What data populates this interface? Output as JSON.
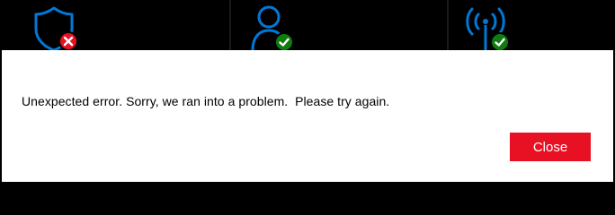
{
  "tiles": [
    {
      "icon": "shield-icon",
      "status": "error",
      "status_icon": "error-badge-icon"
    },
    {
      "icon": "person-icon",
      "status": "ok",
      "status_icon": "check-badge-icon"
    },
    {
      "icon": "wireless-icon",
      "status": "ok",
      "status_icon": "check-badge-icon"
    }
  ],
  "dialog": {
    "message": "Unexpected error. Sorry, we ran into a problem.  Please try again.",
    "close_label": "Close"
  },
  "colors": {
    "accent_blue": "#0078d7",
    "error_red": "#e81123",
    "success_green": "#107c10",
    "button_red": "#e81123"
  }
}
